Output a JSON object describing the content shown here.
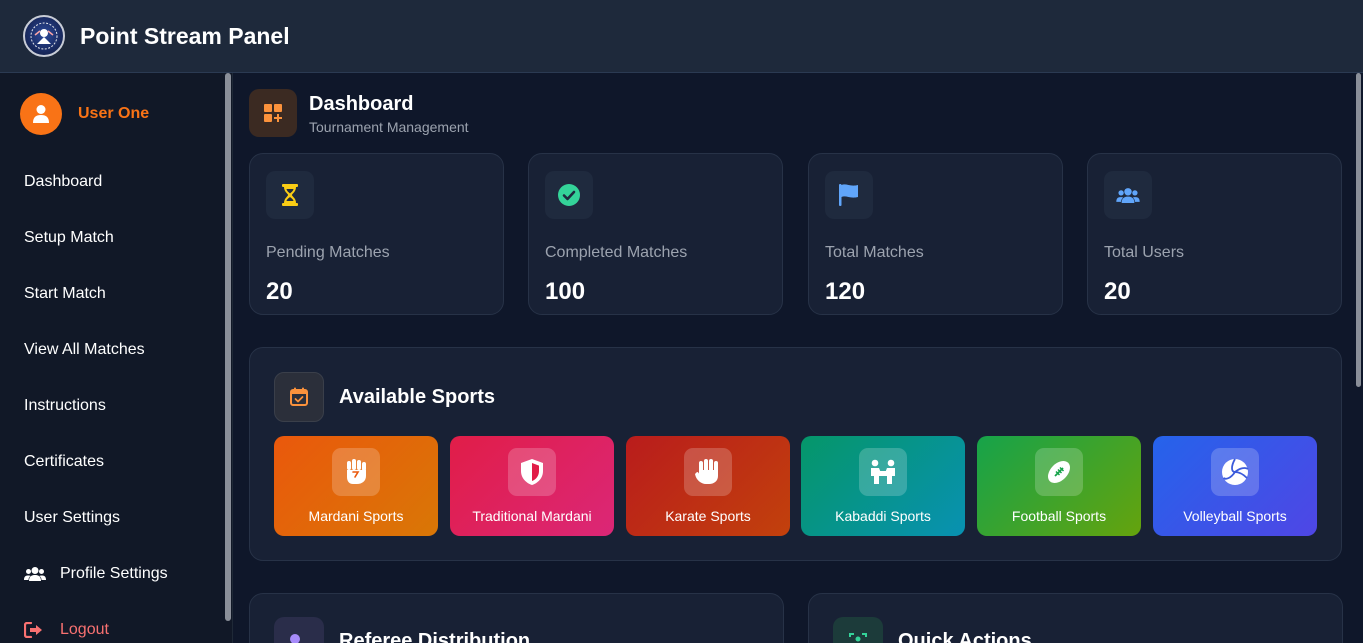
{
  "header": {
    "app_title": "Point Stream Panel",
    "logo_icon": "tournament-logo"
  },
  "sidebar": {
    "user": {
      "name": "User One",
      "avatar_icon": "user-icon",
      "accent": "#f97316"
    },
    "items": [
      {
        "label": "Dashboard"
      },
      {
        "label": "Setup Match"
      },
      {
        "label": "Start Match"
      },
      {
        "label": "View All Matches"
      },
      {
        "label": "Instructions"
      },
      {
        "label": "Certificates"
      },
      {
        "label": "User Settings"
      },
      {
        "label": "Profile Settings",
        "icon": "users-icon"
      },
      {
        "label": "Logout",
        "icon": "logout-icon",
        "color": "#f87171"
      }
    ]
  },
  "dashboard": {
    "title": "Dashboard",
    "subtitle": "Tournament Management",
    "icon": "dashboard-plus-icon"
  },
  "stats": [
    {
      "label": "Pending Matches",
      "value": "20",
      "icon": "hourglass-icon",
      "color": "#facc15"
    },
    {
      "label": "Completed Matches",
      "value": "100",
      "icon": "check-circle-icon",
      "color": "#34d399"
    },
    {
      "label": "Total Matches",
      "value": "120",
      "icon": "flag-icon",
      "color": "#60a5fa"
    },
    {
      "label": "Total Users",
      "value": "20",
      "icon": "users-icon",
      "color": "#60a5fa"
    }
  ],
  "sports": {
    "title": "Available Sports",
    "icon": "calendar-check-icon",
    "items": [
      {
        "label": "Mardani Sports",
        "icon": "fist-icon",
        "gradient": [
          "#ea580c",
          "#d97706"
        ]
      },
      {
        "label": "Traditional Mardani",
        "icon": "shield-icon",
        "gradient": [
          "#e11d48",
          "#db2777"
        ]
      },
      {
        "label": "Karate Sports",
        "icon": "hand-icon",
        "gradient": [
          "#b91c1c",
          "#c2410c"
        ]
      },
      {
        "label": "Kabaddi Sports",
        "icon": "people-icon",
        "gradient": [
          "#059669",
          "#0891b2"
        ]
      },
      {
        "label": "Football Sports",
        "icon": "football-icon",
        "gradient": [
          "#16a34a",
          "#65a30d"
        ]
      },
      {
        "label": "Volleyball Sports",
        "icon": "volleyball-icon",
        "gradient": [
          "#2563eb",
          "#4f46e5"
        ]
      }
    ]
  },
  "bottom": {
    "referee": {
      "title": "Referee Distribution",
      "icon": "referee-icon"
    },
    "quick": {
      "title": "Quick Actions",
      "icon": "quick-actions-icon"
    }
  }
}
